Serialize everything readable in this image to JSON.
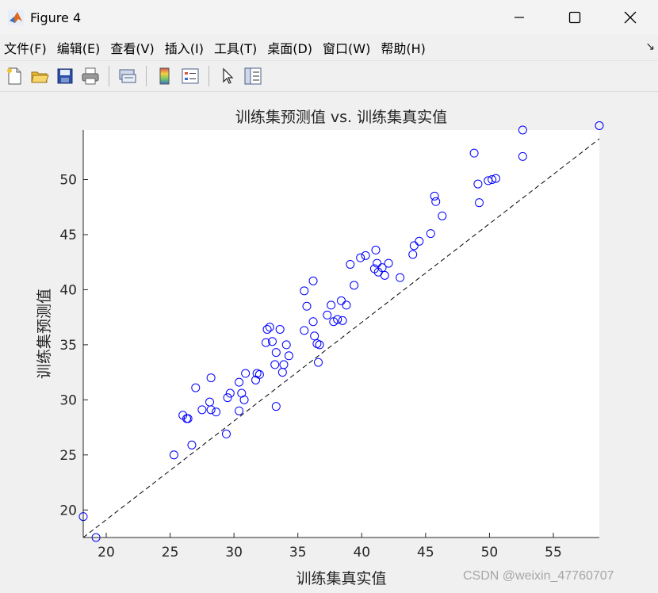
{
  "window": {
    "title": "Figure 4",
    "icon": "matlab-logo-icon",
    "controls": [
      "minimize-icon",
      "maximize-icon",
      "close-icon"
    ]
  },
  "menu": {
    "items": [
      "文件(F)",
      "编辑(E)",
      "查看(V)",
      "插入(I)",
      "工具(T)",
      "桌面(D)",
      "窗口(W)",
      "帮助(H)"
    ],
    "overflow_icon": "dock-arrow-icon"
  },
  "toolbar": {
    "icons": [
      "new-figure-icon",
      "open-file-icon",
      "save-icon",
      "print-icon",
      "link-plot-icon",
      "colorbar-icon",
      "legend-icon",
      "pointer-icon",
      "property-inspector-icon"
    ]
  },
  "watermark": "CSDN @weixin_47760707",
  "chart_data": {
    "type": "scatter",
    "title": "训练集预测值 vs. 训练集真实值",
    "xlabel": "训练集真实值",
    "ylabel": "训练集预测值",
    "xlim": [
      18.2,
      58.6
    ],
    "ylim": [
      17.5,
      54.5
    ],
    "xticks": [
      20,
      25,
      30,
      35,
      40,
      45,
      50,
      55
    ],
    "yticks": [
      20,
      25,
      30,
      35,
      40,
      45,
      50
    ],
    "grid": false,
    "marker": "circle-open",
    "marker_color": "#0000ff",
    "reference_line": {
      "style": "dashed",
      "color": "#000000",
      "from": [
        18.2,
        17.5
      ],
      "to": [
        58.6,
        53.7
      ]
    },
    "x": [
      18.2,
      19.2,
      25.3,
      26.0,
      26.3,
      26.4,
      26.7,
      27.0,
      27.5,
      28.1,
      28.2,
      28.2,
      28.6,
      29.4,
      29.5,
      29.7,
      30.4,
      30.4,
      30.6,
      30.8,
      30.9,
      31.7,
      31.8,
      32.0,
      32.5,
      32.6,
      32.8,
      33.0,
      33.2,
      33.3,
      33.3,
      33.6,
      33.8,
      33.9,
      34.1,
      34.3,
      35.5,
      35.5,
      35.7,
      36.2,
      36.2,
      36.3,
      36.5,
      36.6,
      36.7,
      37.3,
      37.6,
      37.8,
      38.1,
      38.4,
      38.5,
      38.8,
      39.1,
      39.4,
      39.9,
      40.3,
      41.0,
      41.1,
      41.2,
      41.3,
      41.6,
      41.8,
      42.1,
      43.0,
      44.0,
      44.1,
      44.5,
      45.4,
      45.7,
      45.8,
      46.3,
      48.8,
      49.1,
      49.2,
      49.9,
      50.2,
      50.5,
      52.6,
      52.6,
      58.6
    ],
    "y": [
      19.4,
      17.5,
      25.0,
      28.6,
      28.3,
      28.3,
      25.9,
      31.1,
      29.1,
      29.8,
      29.1,
      32.0,
      28.9,
      26.9,
      30.2,
      30.6,
      31.6,
      29.0,
      30.6,
      30.0,
      32.4,
      31.8,
      32.4,
      32.3,
      35.2,
      36.4,
      36.6,
      35.3,
      33.2,
      34.3,
      29.4,
      36.4,
      32.5,
      33.2,
      35.0,
      34.0,
      39.9,
      36.3,
      38.5,
      40.8,
      37.1,
      35.8,
      35.1,
      33.4,
      35.0,
      37.7,
      38.6,
      37.1,
      37.3,
      39.0,
      37.2,
      38.6,
      42.3,
      40.4,
      42.9,
      43.1,
      41.9,
      43.6,
      42.4,
      41.6,
      42.0,
      41.3,
      42.4,
      41.1,
      43.2,
      44.0,
      44.4,
      45.1,
      48.5,
      48.0,
      46.7,
      52.4,
      49.6,
      47.9,
      49.9,
      50.0,
      50.1,
      54.5,
      52.1,
      54.9
    ]
  }
}
